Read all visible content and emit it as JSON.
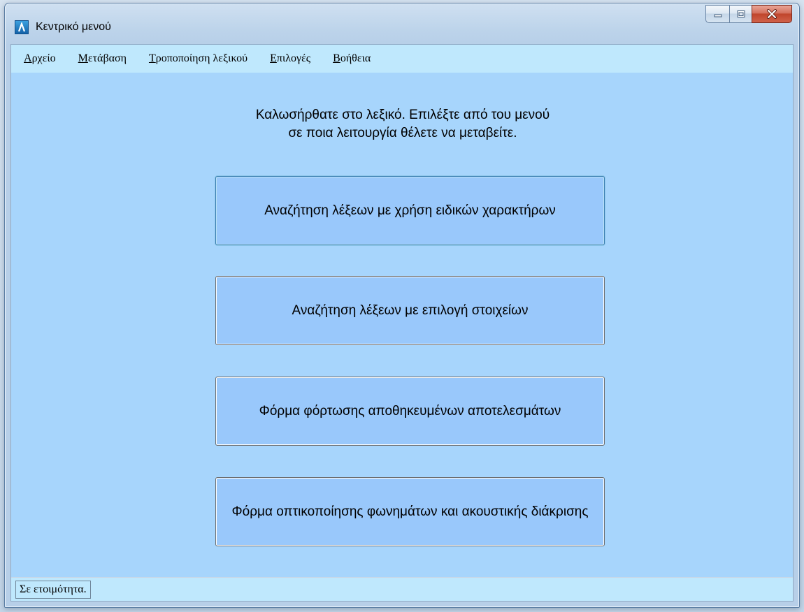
{
  "window": {
    "title": "Κεντρικό μενού",
    "icon": "lambda-app-icon",
    "controls": [
      "minimize-icon",
      "maximize-icon",
      "close-icon"
    ]
  },
  "menu": {
    "items": [
      {
        "accel": "Α",
        "rest": "ρχείο"
      },
      {
        "accel": "Μ",
        "rest": "ετάβαση"
      },
      {
        "accel": "Τ",
        "rest": "ροποποίηση λεξικού"
      },
      {
        "accel": "Ε",
        "rest": "πιλογές"
      },
      {
        "accel": "Β",
        "rest": "οήθεια"
      }
    ]
  },
  "main": {
    "welcome_line1": "Καλωσήρθατε στο λεξικό. Επιλέξτε από του μενού",
    "welcome_line2": "σε ποια λειτουργία θέλετε να μεταβείτε.",
    "buttons": [
      "Αναζήτηση λέξεων με χρήση ειδικών χαρακτήρων",
      "Αναζήτηση λέξεων με επιλογή στοιχείων",
      "Φόρμα φόρτωσης αποθηκευμένων αποτελεσμάτων",
      "Φόρμα οπτικοποίησης φωνημάτων και ακουστικής διάκρισης"
    ]
  },
  "status": {
    "text": "Σε ετοιμότητα."
  },
  "colors": {
    "client_bg": "#a7d5fc",
    "menubar_bg": "#bfe8fd",
    "button_bg": "#99c8fb"
  }
}
